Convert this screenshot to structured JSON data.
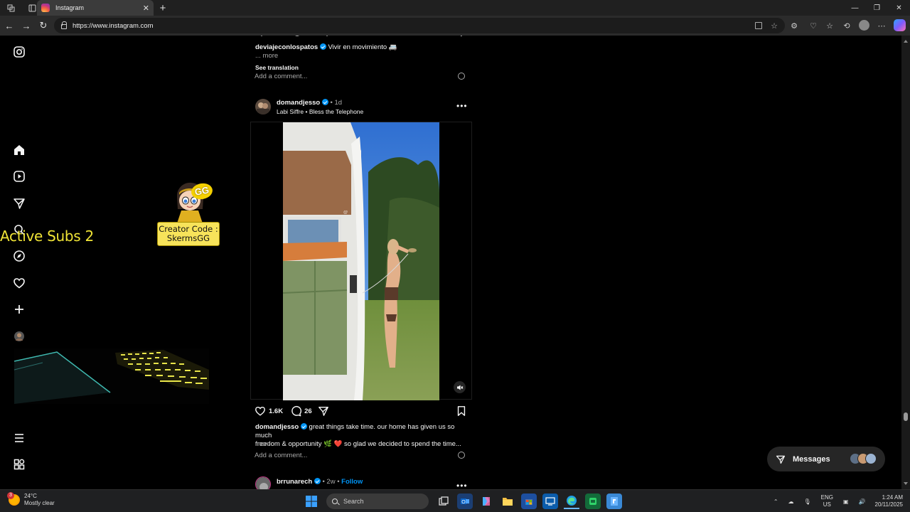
{
  "browser": {
    "tab_title": "Instagram",
    "url": "https://www.instagram.com"
  },
  "overlay": {
    "active_subs": "Active Subs 2",
    "creator_code_line1": "Creator Code :",
    "creator_code_line2": "SkermsGG",
    "gg_badge": "GG"
  },
  "nav_icons": [
    "instagram-logo-icon",
    "home-icon",
    "reels-icon",
    "messages-icon",
    "search-icon",
    "explore-icon",
    "notifications-icon",
    "create-icon",
    "profile-avatar",
    "more-menu-icon",
    "also-from-meta-icon"
  ],
  "prev_post": {
    "username": "deviajeconlospatos",
    "caption": "Vivir en movimiento 🚐",
    "more": "... more",
    "see_translation": "See translation",
    "add_comment": "Add a comment..."
  },
  "post": {
    "username": "domandjesso",
    "separator": "•",
    "time": "1d",
    "audio_artist": "Labi Siffre",
    "audio_track": "Bless the Telephone",
    "likes": "1.6K",
    "comments": "26",
    "caption_line1": "great things take time. our home has given us so much",
    "caption_line2": "freedom & opportunity 🌿 ❤️ so glad we decided to spend the time...",
    "more": "more",
    "add_comment": "Add a comment..."
  },
  "next_post": {
    "username": "brrunarech",
    "time": "2w",
    "follow": "Follow"
  },
  "messages": {
    "label": "Messages"
  },
  "taskbar": {
    "weather_temp": "24°C",
    "weather_desc": "Mostly clear",
    "weather_badge": "3",
    "search_placeholder": "Search",
    "lang1": "ENG",
    "lang2": "US",
    "time": "1:24 AM",
    "date": "20/11/2025"
  },
  "colors": {
    "verified": "#0095f6",
    "follow": "#0095f6",
    "overlay_yellow": "#f0e436"
  }
}
